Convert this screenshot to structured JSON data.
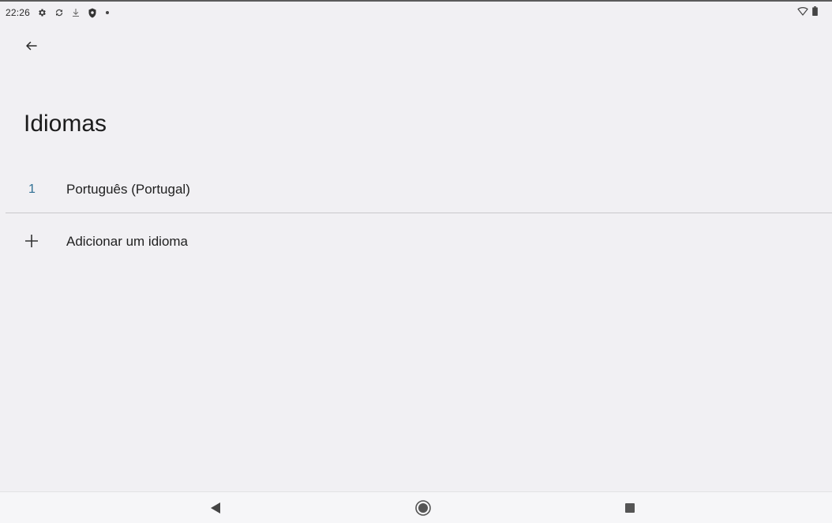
{
  "status_bar": {
    "time": "22:26",
    "icons": [
      "gear-icon",
      "sync-icon",
      "download-icon",
      "shield-icon",
      "dot-icon"
    ],
    "right_icons": [
      "wifi-icon",
      "battery-icon"
    ]
  },
  "page": {
    "title": "Idiomas"
  },
  "languages": [
    {
      "index": "1",
      "name": "Português (Portugal)"
    }
  ],
  "add_language": {
    "label": "Adicionar um idioma"
  },
  "colors": {
    "accent_index": "#2f6f93",
    "background": "#f1f0f3"
  }
}
